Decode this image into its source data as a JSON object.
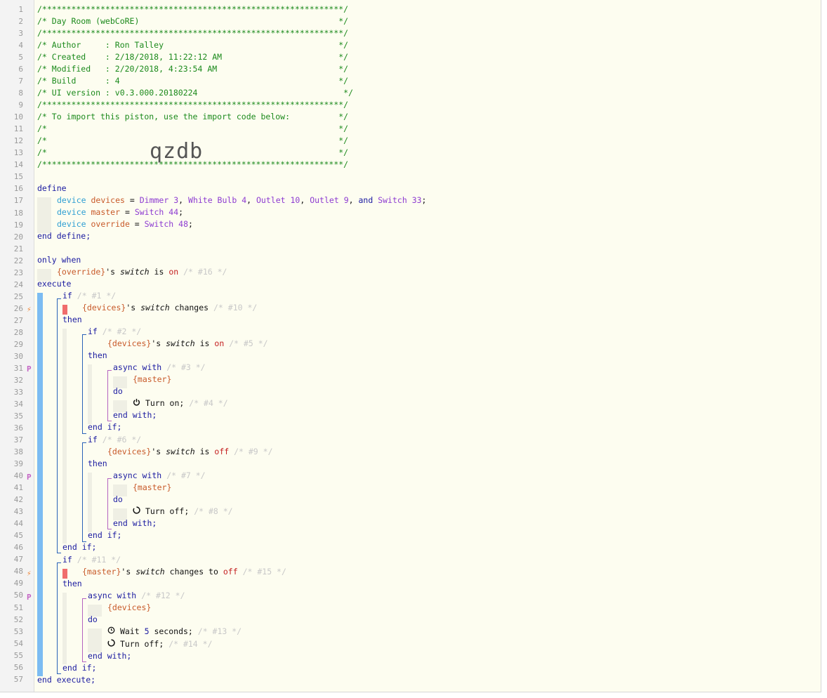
{
  "editor": {
    "line_numbers": [
      "1",
      "2",
      "3",
      "4",
      "5",
      "6",
      "7",
      "8",
      "9",
      "10",
      "11",
      "12",
      "13",
      "14",
      "15",
      "16",
      "17",
      "18",
      "19",
      "20",
      "21",
      "22",
      "23",
      "24",
      "25",
      "26",
      "27",
      "28",
      "29",
      "30",
      "31",
      "32",
      "33",
      "34",
      "35",
      "36",
      "37",
      "38",
      "39",
      "40",
      "41",
      "42",
      "43",
      "44",
      "45",
      "46",
      "47",
      "48",
      "49",
      "50",
      "51",
      "52",
      "53",
      "54",
      "55",
      "56",
      "57"
    ],
    "header": {
      "stars": "/**************************************************************/",
      "title": "/* Day Room (webCoRE)                                         */",
      "author": "/* Author     : Ron Talley                                    */",
      "created": "/* Created    : 2/18/2018, 11:22:12 AM                        */",
      "modified": "/* Modified   : 2/20/2018, 4:23:54 AM                         */",
      "build": "/* Build      : 4                                             */",
      "ui_version": "/* UI version : v0.3.000.20180224                              */",
      "import_note": "/* To import this piston, use the import code below:          */",
      "blank": "/*                                                            */",
      "import_code": "qzdb"
    },
    "define": {
      "kw_define": "define",
      "kw_device": "device",
      "devices_var": "devices",
      "master_var": "master",
      "override_var": "override",
      "eq": " = ",
      "dimmer": "Dimmer",
      "dimmer_num": "3",
      "white_bulb": "White Bulb",
      "white_bulb_num": "4",
      "outlet10": "Outlet",
      "outlet10_num": "10",
      "outlet9": "Outlet",
      "outlet9_num": "9",
      "and": "and",
      "switch33": "Switch",
      "switch33_num": "33",
      "switch44": "Switch",
      "switch44_num": "44",
      "switch48": "Switch",
      "switch48_num": "48",
      "end_define": "end define;"
    },
    "restrictions": {
      "only_when": "only when",
      "override_ref": "{override}",
      "possessive": "'s",
      "attr_switch": "switch",
      "is": "is",
      "on": "on",
      "off": "off",
      "cm16": "/* #16 */"
    },
    "execute": {
      "execute": "execute",
      "end_execute": "end execute;",
      "if": "if",
      "then": "then",
      "do": "do",
      "end_if": "end if;",
      "async_with": "async with",
      "end_with": "end with;",
      "devices_ref": "{devices}",
      "master_ref": "{master}",
      "changes": "changes",
      "changes_to": "changes to",
      "turn_on": "Turn on;",
      "turn_off": "Turn off;",
      "wait": "Wait",
      "wait_num": "5",
      "seconds": "seconds;",
      "cm1": "/* #1 */",
      "cm10": "/* #10 */",
      "cm2": "/* #2 */",
      "cm5": "/* #5 */",
      "cm3": "/* #3 */",
      "cm4": "/* #4 */",
      "cm6": "/* #6 */",
      "cm9": "/* #9 */",
      "cm7": "/* #7 */",
      "cm8": "/* #8 */",
      "cm11": "/* #11 */",
      "cm15": "/* #15 */",
      "cm12": "/* #12 */",
      "cm13": "/* #13 */",
      "cm14": "/* #14 */"
    },
    "gutter_marks": {
      "trigger": "⚡",
      "async": "P"
    },
    "colors": {
      "background": "#fdfdf0",
      "keyword": "#1a1aa0",
      "comment": "#1c8a1c",
      "variable": "#c85a2a",
      "device": "#8d3bd1",
      "value": "#c42020",
      "bar": "#7cbcf2",
      "trigger": "#f06c6c"
    }
  }
}
